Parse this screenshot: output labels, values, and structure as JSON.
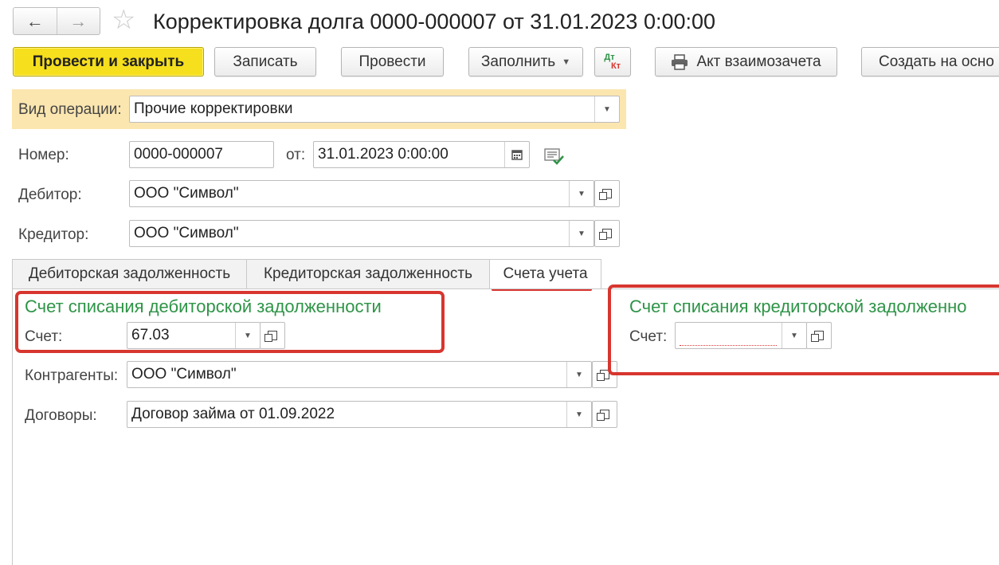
{
  "header": {
    "back_icon": "←",
    "forward_icon": "→",
    "star_icon": "☆",
    "title": "Корректировка долга 0000-000007 от 31.01.2023 0:00:00"
  },
  "toolbar": {
    "post_close": "Провести и закрыть",
    "save": "Записать",
    "post": "Провести",
    "fill": "Заполнить",
    "dtkt_top": "Дт",
    "dtkt_bottom": "Кт",
    "netting_act": "Акт взаимозачета",
    "create_based": "Создать на осно"
  },
  "form": {
    "op_type_label": "Вид операции:",
    "op_type_value": "Прочие корректировки",
    "number_label": "Номер:",
    "number_value": "0000-000007",
    "date_label": "от:",
    "date_value": "31.01.2023  0:00:00",
    "debtor_label": "Дебитор:",
    "debtor_value": "ООО \"Символ\"",
    "creditor_label": "Кредитор:",
    "creditor_value": "ООО \"Символ\""
  },
  "tabs": [
    {
      "label": "Дебиторская задолженность"
    },
    {
      "label": "Кредиторская задолженность"
    },
    {
      "label": "Счета учета"
    }
  ],
  "accounts": {
    "debit_heading": "Счет списания дебиторской задолженности",
    "account_label": "Счет:",
    "debit_account": "67.03",
    "counterparties_label": "Контрагенты:",
    "counterparties_value": "ООО \"Символ\"",
    "contracts_label": "Договоры:",
    "contracts_value": "Договор займа от 01.09.2022",
    "credit_heading": "Счет списания кредиторской задолженно",
    "credit_account_label": "Счет:",
    "credit_account": ""
  },
  "colors": {
    "primary_button": "#f6df1c",
    "op_band": "#fbe6b0",
    "heading_green": "#2e9447",
    "highlight_red": "#d7362f"
  }
}
